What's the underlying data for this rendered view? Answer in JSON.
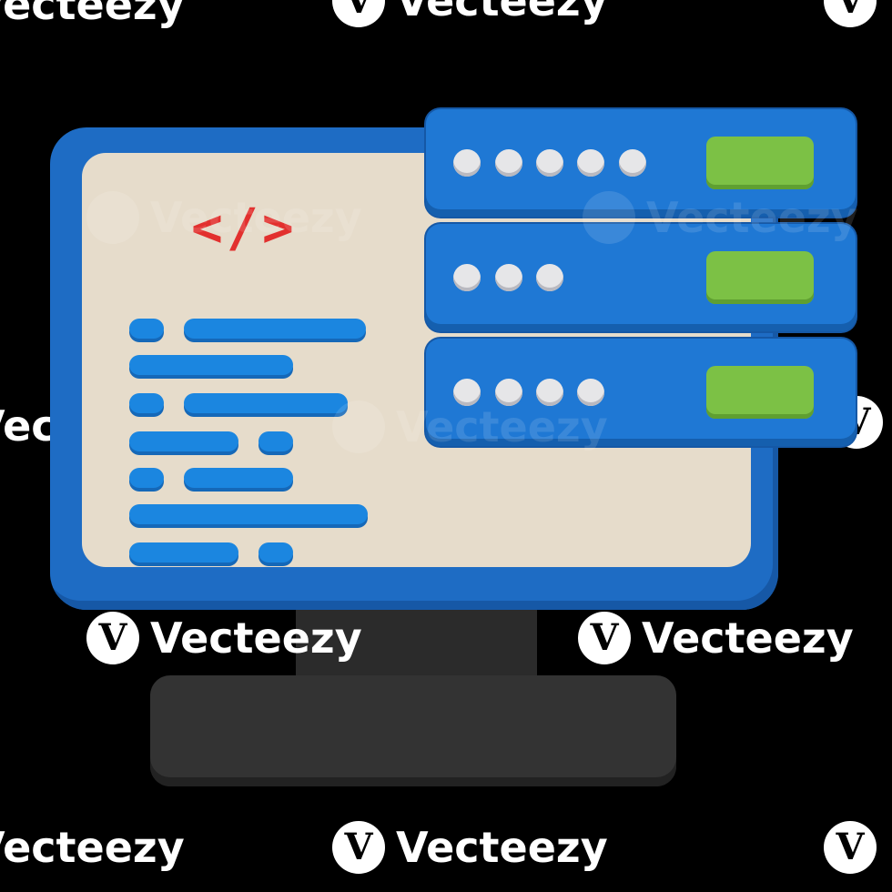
{
  "watermark": {
    "brand": "Vecteezy",
    "logo_letter": "V"
  },
  "illustration": {
    "code_symbol": "</>",
    "code_lines": 7,
    "servers": [
      {
        "dots": 5,
        "status": "active"
      },
      {
        "dots": 3,
        "status": "active"
      },
      {
        "dots": 4,
        "status": "active"
      }
    ]
  },
  "colors": {
    "monitor_frame": "#1e6cc4",
    "screen": "#e6dccb",
    "code_symbol": "#e2302e",
    "code_line": "#1b86e0",
    "server_panel": "#1f78d4",
    "server_led": "#7cc145",
    "stand": "#333333"
  }
}
